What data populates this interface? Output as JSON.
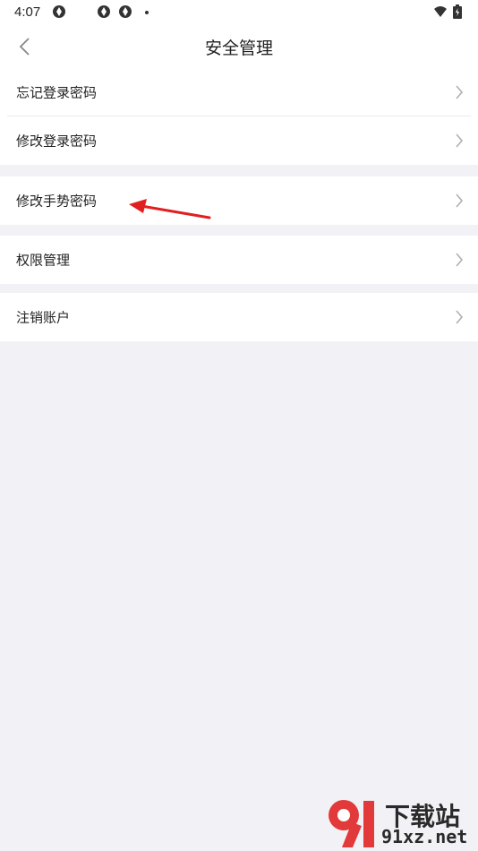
{
  "status_bar": {
    "time": "4:07",
    "icons": [
      "notification-icon",
      "notification-icon",
      "notification-icon",
      "wifi-icon",
      "battery-icon"
    ]
  },
  "header": {
    "title": "安全管理",
    "back_icon": "chevron-left-icon"
  },
  "groups": [
    {
      "items": [
        {
          "label": "忘记登录密码"
        },
        {
          "label": "修改登录密码"
        }
      ]
    },
    {
      "items": [
        {
          "label": "修改手势密码"
        }
      ]
    },
    {
      "items": [
        {
          "label": "权限管理"
        }
      ]
    },
    {
      "items": [
        {
          "label": "注销账户"
        }
      ]
    }
  ],
  "annotation": {
    "icon": "red-arrow-icon",
    "color": "#e02020"
  },
  "watermark": {
    "chinese": "下载站",
    "site": "91xz.net",
    "mark": "91"
  },
  "colors": {
    "background": "#f2f2f6",
    "card": "#ffffff",
    "text": "#222222",
    "arrow": "#b0b0b0"
  }
}
